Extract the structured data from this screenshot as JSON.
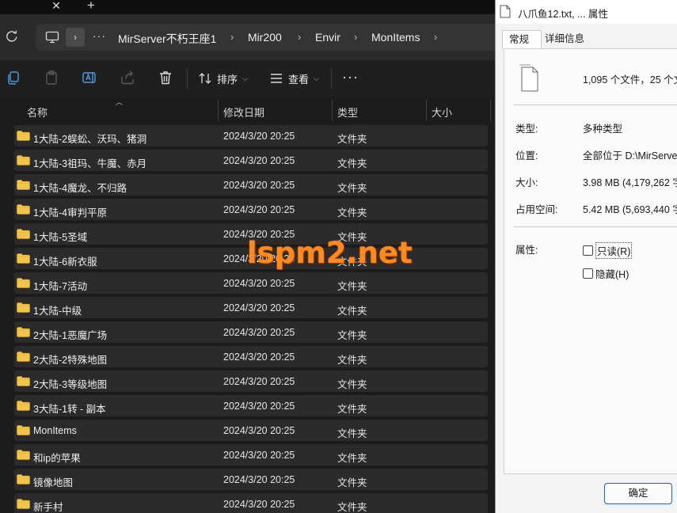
{
  "explorer": {
    "tab_bar": {
      "close_icon": "close-icon",
      "new_tab_icon": "plus-icon"
    },
    "breadcrumb": [
      "MirServer不朽王座1",
      "Mir200",
      "Envir",
      "MonItems"
    ],
    "command_bar": {
      "sort_label": "排序",
      "view_label": "查看"
    },
    "columns": {
      "name": "名称",
      "modified": "修改日期",
      "type": "类型",
      "size": "大小"
    },
    "rows": [
      {
        "name": "1大陆-2蜈蚣、沃玛、猪洞",
        "date": "2024/3/20 20:25",
        "type": "文件夹"
      },
      {
        "name": "1大陆-3祖玛、牛魔、赤月",
        "date": "2024/3/20 20:25",
        "type": "文件夹"
      },
      {
        "name": "1大陆-4魔龙、不归路",
        "date": "2024/3/20 20:25",
        "type": "文件夹"
      },
      {
        "name": "1大陆-4审判平原",
        "date": "2024/3/20 20:25",
        "type": "文件夹"
      },
      {
        "name": "1大陆-5圣域",
        "date": "2024/3/20 20:25",
        "type": "文件夹"
      },
      {
        "name": "1大陆-6新衣服",
        "date": "2024/3/20 20:25",
        "type": "文件夹"
      },
      {
        "name": "1大陆-7活动",
        "date": "2024/3/20 20:25",
        "type": "文件夹"
      },
      {
        "name": "1大陆-中级",
        "date": "2024/3/20 20:25",
        "type": "文件夹"
      },
      {
        "name": "2大陆-1恶魔广场",
        "date": "2024/3/20 20:25",
        "type": "文件夹"
      },
      {
        "name": "2大陆-2特殊地图",
        "date": "2024/3/20 20:25",
        "type": "文件夹"
      },
      {
        "name": "2大陆-3等级地图",
        "date": "2024/3/20 20:25",
        "type": "文件夹"
      },
      {
        "name": "3大陆-1转 - 副本",
        "date": "2024/3/20 20:25",
        "type": "文件夹"
      },
      {
        "name": "MonItems",
        "date": "2024/3/20 20:25",
        "type": "文件夹"
      },
      {
        "name": "和ip的苹果",
        "date": "2024/3/20 20:25",
        "type": "文件夹"
      },
      {
        "name": "镜像地图",
        "date": "2024/3/20 20:25",
        "type": "文件夹"
      },
      {
        "name": "新手村",
        "date": "2024/3/20 20:25",
        "type": "文件夹"
      }
    ],
    "colors": {
      "row_bg": "#2b2b2b",
      "folder": "#f2c447",
      "accent": "#4a9be8"
    }
  },
  "watermark": "lspm2.net",
  "dialog": {
    "title": "八爪鱼12.txt, ... 属性",
    "tabs": [
      "常规",
      "详细信息"
    ],
    "summary": "1,095 个文件，25 个文",
    "fields": [
      {
        "label": "类型:",
        "value": "多种类型"
      },
      {
        "label": "位置:",
        "value": "全部位于 D:\\MirServer"
      },
      {
        "label": "大小:",
        "value": "3.98 MB (4,179,262 字"
      },
      {
        "label": "占用空间:",
        "value": "5.42 MB (5,693,440 字"
      }
    ],
    "attributes_label": "属性:",
    "readonly_label": "只读(R)",
    "hidden_label": "隐藏(H)",
    "ok_label": "确定"
  }
}
